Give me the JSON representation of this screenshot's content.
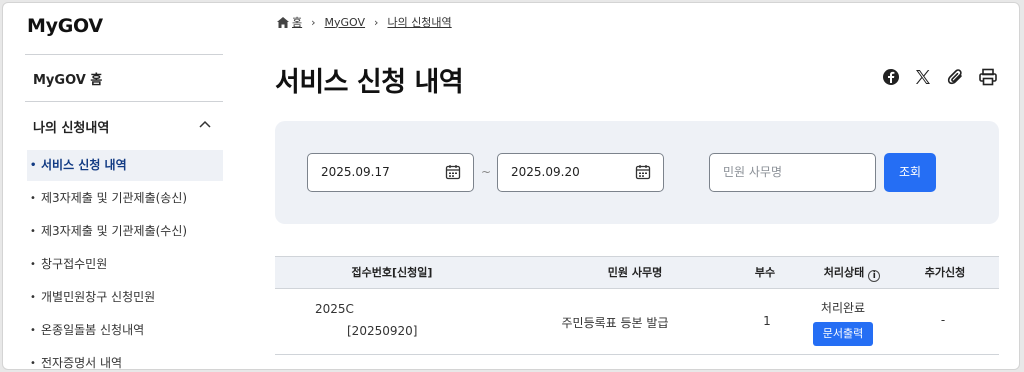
{
  "sidebar": {
    "logo": "MyGOV",
    "home": "MyGOV 홈",
    "group": "나의 신청내역",
    "items": [
      {
        "label": "서비스 신청 내역"
      },
      {
        "label": "제3자제출 및 기관제출(송신)"
      },
      {
        "label": "제3자제출 및 기관제출(수신)"
      },
      {
        "label": "창구접수민원"
      },
      {
        "label": "개별민원창구 신청민원"
      },
      {
        "label": "온종일돌봄 신청내역"
      },
      {
        "label": "전자증명서 내역"
      }
    ]
  },
  "breadcrumb": {
    "home": "홈",
    "mygov": "MyGOV",
    "current": "나의 신청내역"
  },
  "page": {
    "title": "서비스 신청 내역"
  },
  "toolbar": {
    "icons": [
      "facebook-icon",
      "x-icon",
      "attach-icon",
      "print-icon"
    ]
  },
  "filter": {
    "start_date": "2025.09.17",
    "end_date": "2025.09.20",
    "separator": "~",
    "search_placeholder": "민원 사무명",
    "search_button": "조회"
  },
  "table": {
    "headers": [
      "접수번호[신청일]",
      "민원 사무명",
      "부수",
      "처리상태",
      "추가신청"
    ],
    "rows": [
      {
        "receipt_no": "2025C",
        "date": "[20250920]",
        "name": "주민등록표 등본 발급",
        "copies": "1",
        "status": "처리완료",
        "action": "문서출력",
        "extra": "-"
      }
    ]
  },
  "colors": {
    "accent": "#256ef4",
    "panel": "#eef1f6",
    "active_text": "#113a83"
  }
}
